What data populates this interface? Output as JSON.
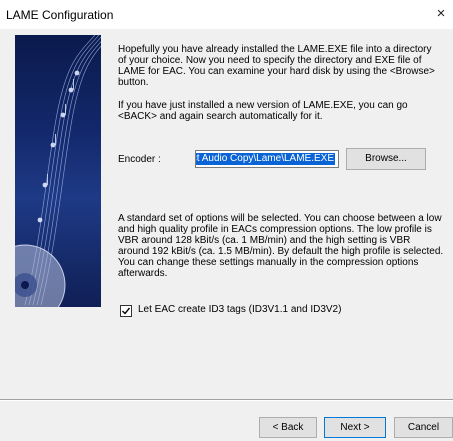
{
  "window": {
    "title": "LAME Configuration",
    "close_glyph": "×",
    "close_icon": "close-icon"
  },
  "art": {
    "description_icon": "music-score-cd-art"
  },
  "intro": {
    "p1": "Hopefully you have already installed the LAME.EXE file into a directory of your choice. Now you need to specify the directory and EXE file of LAME for EAC. You can examine your hard disk by using the <Browse> button.",
    "p2": "If you have just installed a new version of LAME.EXE, you can go <BACK> and again search automatically for it."
  },
  "encoder": {
    "label": "Encoder :",
    "value": "act Audio Copy\\Lame\\LAME.EXE",
    "browse_label": "Browse..."
  },
  "options_text": "A standard set of options will be selected. You can choose between a low and high quality profile in EACs compression options. The low profile is VBR around 128 kBit/s (ca. 1 MB/min) and the high setting is VBR around 192 kBit/s (ca. 1.5 MB/min). By default the high profile is selected. You can change these settings manually in the compression options afterwards.",
  "id3": {
    "label": "Let EAC create ID3 tags (ID3V1.1 and ID3V2)",
    "checked": true
  },
  "footer": {
    "back_label": "< Back",
    "next_label": "Next >",
    "cancel_label": "Cancel"
  },
  "colors": {
    "selection": "#0a64d6",
    "art_dark": "#0b1a4c",
    "art_light": "#1e3a86",
    "default_border": "#0078d7"
  }
}
